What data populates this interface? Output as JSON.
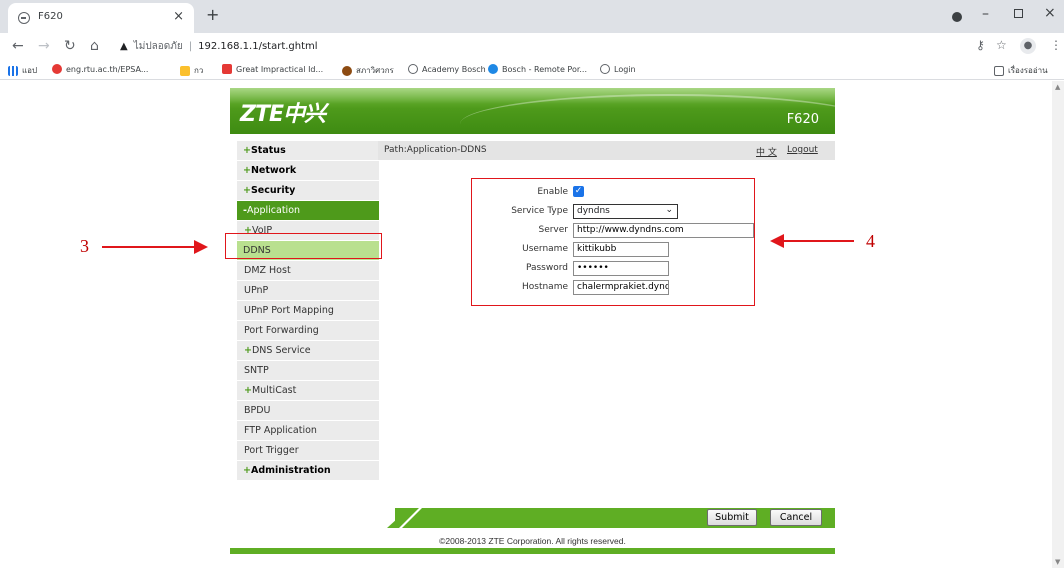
{
  "browser": {
    "tab_title": "F620",
    "tab_close": "×",
    "new_tab": "+",
    "not_secure": "ไม่ปลอดภัย",
    "url": "192.168.1.1/start.ghtml",
    "window": {
      "minimize": "–",
      "close": "×"
    },
    "bookmarks": [
      {
        "label": "แอป",
        "color": "#1a73e8"
      },
      {
        "label": "eng.rtu.ac.th/EPSA...",
        "color": "#e53935"
      },
      {
        "label": "กว",
        "color": "#fbc02d"
      },
      {
        "label": "Great Impractical Id...",
        "color": "#e53935"
      },
      {
        "label": "สภาวิศวกร",
        "color": "#8d4b12"
      },
      {
        "label": "Academy Bosch",
        "color": "#5f6368"
      },
      {
        "label": "Bosch - Remote Por...",
        "color": "#1e88e5"
      },
      {
        "label": "Login",
        "color": "#5f6368"
      }
    ],
    "reading_list": "เรื่องรออ่าน"
  },
  "router": {
    "brand": "ZTE中兴",
    "model": "F620",
    "path": "Path:Application-DDNS",
    "lang_link": "中 文",
    "logout": "Logout",
    "menu": [
      {
        "label": "Status",
        "prefix": "+",
        "kind": "top"
      },
      {
        "label": "Network",
        "prefix": "+",
        "kind": "top"
      },
      {
        "label": "Security",
        "prefix": "+",
        "kind": "top"
      },
      {
        "label": "Application",
        "prefix": "-",
        "kind": "active"
      },
      {
        "label": "VoIP",
        "prefix": "+",
        "kind": "sub-plus"
      },
      {
        "label": "DDNS",
        "prefix": "",
        "kind": "selected"
      },
      {
        "label": "DMZ Host",
        "prefix": "",
        "kind": "sub"
      },
      {
        "label": "UPnP",
        "prefix": "",
        "kind": "sub"
      },
      {
        "label": "UPnP Port Mapping",
        "prefix": "",
        "kind": "sub"
      },
      {
        "label": "Port Forwarding",
        "prefix": "",
        "kind": "sub"
      },
      {
        "label": "DNS Service",
        "prefix": "+",
        "kind": "sub-plus"
      },
      {
        "label": "SNTP",
        "prefix": "",
        "kind": "sub"
      },
      {
        "label": "MultiCast",
        "prefix": "+",
        "kind": "sub-plus"
      },
      {
        "label": "BPDU",
        "prefix": "",
        "kind": "sub"
      },
      {
        "label": "FTP Application",
        "prefix": "",
        "kind": "sub"
      },
      {
        "label": "Port Trigger",
        "prefix": "",
        "kind": "sub"
      },
      {
        "label": "Administration",
        "prefix": "+",
        "kind": "top"
      }
    ],
    "form": {
      "enable_label": "Enable",
      "enable_checked": true,
      "service_type_label": "Service Type",
      "service_type_value": "dyndns",
      "server_label": "Server",
      "server_value": "http://www.dyndns.com",
      "username_label": "Username",
      "username_value": "kittikubb",
      "password_label": "Password",
      "password_value": "••••••",
      "hostname_label": "Hostname",
      "hostname_value": "chalermprakiet.dynd"
    },
    "submit": "Submit",
    "cancel": "Cancel",
    "copyright": "©2008-2013 ZTE Corporation. All rights reserved."
  },
  "annotations": {
    "left_number": "3",
    "right_number": "4",
    "color": "#e0161b"
  }
}
